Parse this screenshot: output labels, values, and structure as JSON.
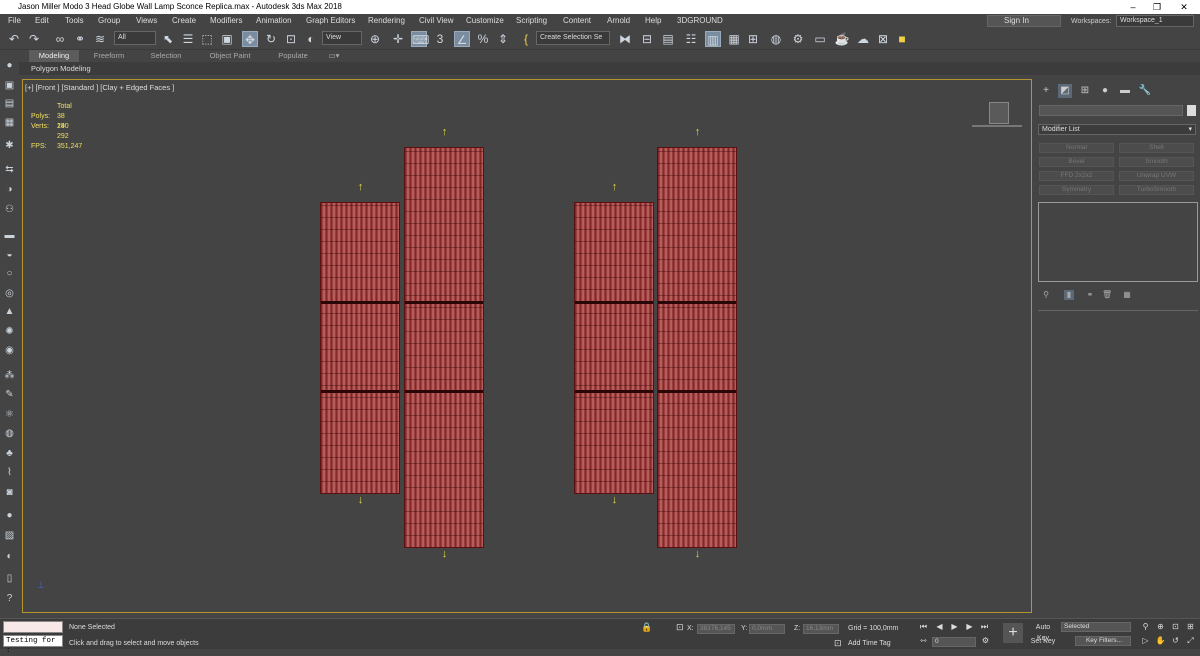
{
  "window": {
    "title": "Jason Miller Modo 3 Head Globe Wall Lamp Sconce Replica.max - Autodesk 3ds Max 2018",
    "minimize": "–",
    "restore": "❐",
    "close": "✕"
  },
  "menu": [
    "File",
    "Edit",
    "Tools",
    "Group",
    "Views",
    "Create",
    "Modifiers",
    "Animation",
    "Graph Editors",
    "Rendering",
    "Civil View",
    "Customize",
    "Scripting",
    "Content",
    "Arnold",
    "Help",
    "3DGROUND"
  ],
  "account": {
    "sign_in": "Sign In",
    "workspaces_label": "Workspaces:",
    "workspace": "Workspace_1"
  },
  "toolbar": {
    "filter": "All",
    "ref_coord": "View",
    "selection_set": "Create Selection Se",
    "snap_value": "3"
  },
  "ribbon": {
    "tabs": [
      "Modeling",
      "Freeform",
      "Selection",
      "Object Paint",
      "Populate"
    ],
    "active": "Modeling",
    "subtitle": "Polygon Modeling"
  },
  "viewport": {
    "label": "[+] [Front ] [Standard ] [Clay + Edged Faces ]",
    "stats": {
      "total_label": "Total",
      "polys_label": "Polys:",
      "polys": "38 240",
      "verts_label": "Verts:",
      "verts": "19 292",
      "fps_label": "FPS:",
      "fps": "351,247"
    }
  },
  "command_panel": {
    "modifier_list": "Modifier List",
    "modifier_buttons": [
      "Normal",
      "Shell",
      "Bevel",
      "Smooth",
      "FFD 2x2x2",
      "Unwrap UVW",
      "Symmetry",
      "TurboSmooth"
    ]
  },
  "status": {
    "maxscript": "Testing for :",
    "selection": "None Selected",
    "prompt": "Click and drag to select and move objects",
    "x_label": "X:",
    "x": "38176,145",
    "y_label": "Y:",
    "y": "0,0mm",
    "z_label": "Z:",
    "z": "16,13mm",
    "grid": "Grid = 100,0mm",
    "add_time_tag": "Add Time Tag",
    "auto_key": "Auto Key",
    "set_key": "Set Key",
    "selected": "Selected",
    "key_filters": "Key Filters...",
    "frame": "0"
  },
  "colors": {
    "accent": "#b49532",
    "cylinder": "#a84848",
    "arrow": "#e8d840"
  }
}
